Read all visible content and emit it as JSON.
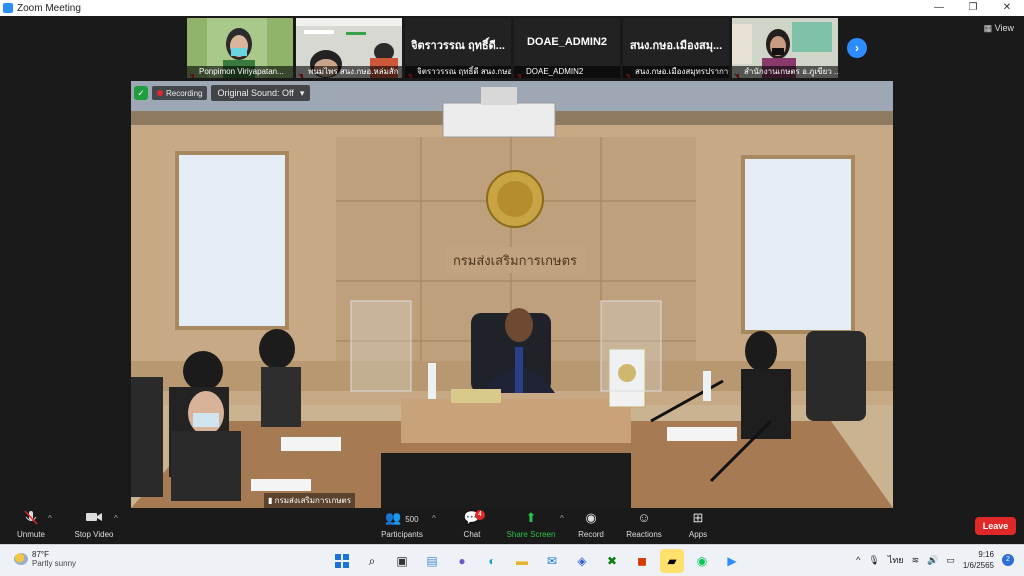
{
  "window": {
    "title": "Zoom Meeting",
    "controls": [
      "—",
      "❐",
      "✕"
    ]
  },
  "gallery": {
    "view_label": "View",
    "participants": [
      {
        "caption": "Ponpimon Viriyapatan...",
        "video": true
      },
      {
        "caption": "พนมไพร สนง.กษอ.หล่มสัก",
        "video": true
      },
      {
        "caption": "จิตราวรรณ ฤทธิ์ดี สนง.กษอ.ท่า...",
        "video": false,
        "display_name": "จิตราวรรณ ฤทธิ์ดี..."
      },
      {
        "caption": "DOAE_ADMIN2",
        "video": false,
        "display_name": "DOAE_ADMIN2"
      },
      {
        "caption": "สนง.กษอ.เมืองสมุทรปราการ...",
        "video": false,
        "display_name": "สนง.กษอ.เมืองสมุ..."
      },
      {
        "caption": "สำนักงานเกษตร อ.ภูเขียว ...",
        "video": true
      }
    ]
  },
  "main_video": {
    "recording_label": "Recording",
    "original_sound": "Original Sound: Off",
    "speaker_name": "กรมส่งเสริมการเกษตร",
    "sign_text": "กรมส่งเสริมการเกษตร"
  },
  "toolbar": {
    "unmute": "Unmute",
    "stop_video": "Stop Video",
    "participants": "Participants",
    "participants_count": "500",
    "chat": "Chat",
    "chat_badge": "4",
    "share_screen": "Share Screen",
    "record": "Record",
    "reactions": "Reactions",
    "apps": "Apps",
    "leave": "Leave"
  },
  "taskbar": {
    "temp": "87°F",
    "condition": "Partly sunny",
    "language": "ไทย",
    "time": "9:16",
    "date": "1/6/2565",
    "notification_count": "2"
  }
}
